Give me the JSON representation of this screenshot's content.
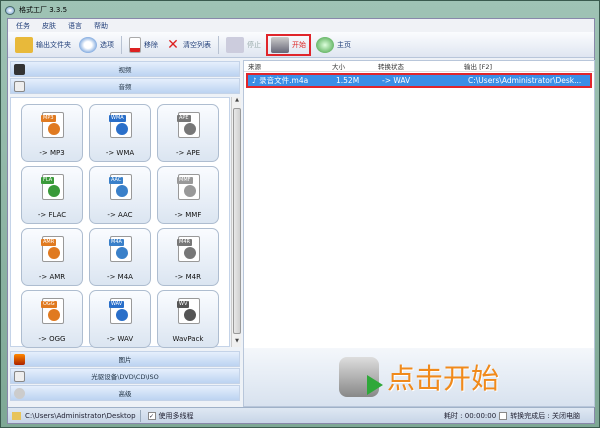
{
  "window": {
    "title": "格式工厂 3.3.5"
  },
  "menu": [
    "任务",
    "皮肤",
    "语言",
    "帮助"
  ],
  "toolbar": {
    "output_folder": "输出文件夹",
    "options": "选项",
    "remove": "移除",
    "clear_list": "清空列表",
    "stop": "停止",
    "start": "开始",
    "home": "主页"
  },
  "categories": {
    "video": "视频",
    "audio": "音频",
    "picture": "图片",
    "rom": "光驱设备\\DVD\\CD\\ISO",
    "advanced": "高级"
  },
  "tiles": [
    {
      "tag": "MP3",
      "label": "-> MP3",
      "color": "#e07a20"
    },
    {
      "tag": "WMA",
      "label": "-> WMA",
      "color": "#2a6fc9"
    },
    {
      "tag": "APE",
      "label": "-> APE",
      "color": "#777777"
    },
    {
      "tag": "FLA",
      "label": "-> FLAC",
      "color": "#3a9a3a"
    },
    {
      "tag": "AAC",
      "label": "-> AAC",
      "color": "#3a80c9"
    },
    {
      "tag": "MMF",
      "label": "-> MMF",
      "color": "#999999"
    },
    {
      "tag": "AMR",
      "label": "-> AMR",
      "color": "#e07a20"
    },
    {
      "tag": "M4A",
      "label": "-> M4A",
      "color": "#3a80c9"
    },
    {
      "tag": "M4R",
      "label": "-> M4R",
      "color": "#777777"
    },
    {
      "tag": "OGG",
      "label": "-> OGG",
      "color": "#e07a20"
    },
    {
      "tag": "WAV",
      "label": "-> WAV",
      "color": "#2a6fc9"
    },
    {
      "tag": "WV",
      "label": "WavPack",
      "color": "#555555"
    }
  ],
  "list": {
    "headers": [
      "来源",
      "大小",
      "转换状态",
      "输出 [F2]"
    ],
    "rows": [
      {
        "source": "录音文件.m4a",
        "size": "1.52M",
        "status": "-> WAV",
        "output": "C:\\Users\\Administrator\\Desk..."
      }
    ]
  },
  "banner": "点击开始",
  "status": {
    "path": "C:\\Users\\Administrator\\Desktop",
    "multithread": "使用多线程",
    "multithread_checked": true,
    "elapsed": "耗时 : 00:00:00",
    "after": "转换完成后 : 关闭电脑",
    "after_checked": false
  }
}
